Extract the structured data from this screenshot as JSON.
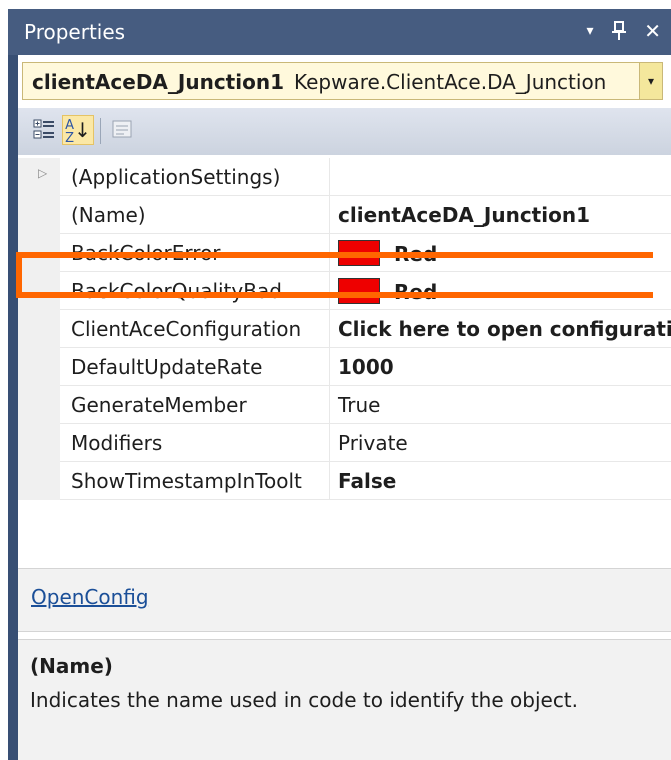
{
  "window": {
    "title": "Properties",
    "dropdown_icon": "▾",
    "pin_icon": "📌",
    "close_icon": "✕"
  },
  "object_selector": {
    "object_name": "clientAceDA_Junction1",
    "object_type": "Kepware.ClientAce.DA_Junction",
    "dropdown_glyph": "▾"
  },
  "toolbar": {
    "categorized_label": "Categorized",
    "alphabetical_label": "Alphabetical",
    "property_pages_label": "Property Pages"
  },
  "properties": [
    {
      "name": "(ApplicationSettings)",
      "value": "",
      "expandable": true,
      "bold": false
    },
    {
      "name": "(Name)",
      "value": "clientAceDA_Junction1",
      "bold": true
    },
    {
      "name": "BackColorError",
      "value": "Red",
      "bold": true,
      "swatch": "#ee0000"
    },
    {
      "name": "BackColorQualityBad",
      "value": "Red",
      "bold": true,
      "swatch": "#ee0000"
    },
    {
      "name": "ClientAceConfiguration",
      "value": "Click here to open configurati",
      "bold": true,
      "highlighted": true
    },
    {
      "name": "DefaultUpdateRate",
      "value": "1000",
      "bold": true
    },
    {
      "name": "GenerateMember",
      "value": "True",
      "bold": false
    },
    {
      "name": "Modifiers",
      "value": "Private",
      "bold": false
    },
    {
      "name": "ShowTimestampInToolt",
      "value": "False",
      "bold": true
    }
  ],
  "commands": {
    "open_config_link": "OpenConfig"
  },
  "description": {
    "title": "(Name)",
    "text": "Indicates the name used in code to identify the object."
  },
  "colors": {
    "highlight_border": "#ff6600",
    "title_bar": "#465c80",
    "link": "#1b4f98",
    "selector_bg": "#fff9dc"
  }
}
